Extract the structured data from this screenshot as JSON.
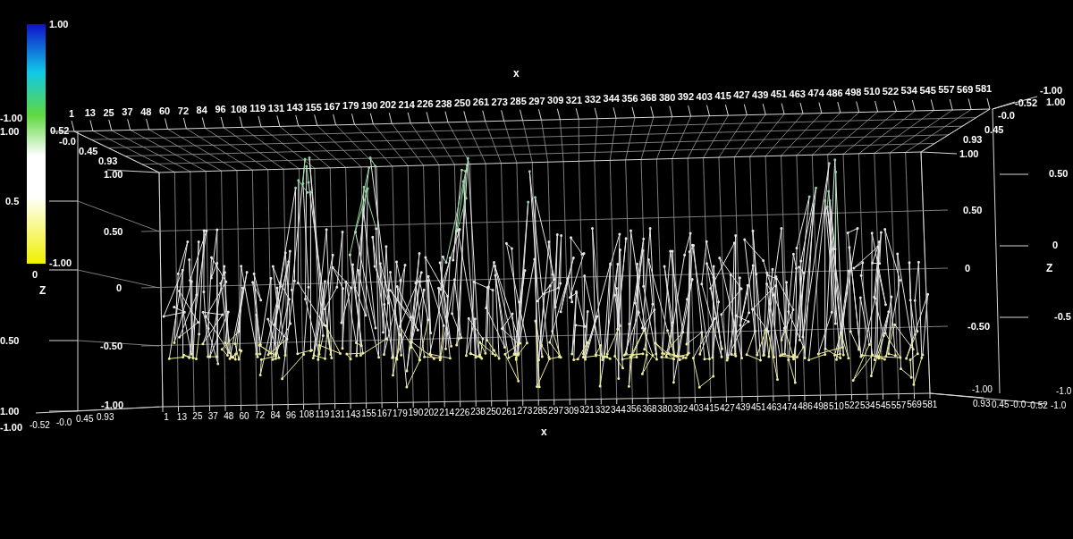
{
  "colorbar": {
    "texts": [
      "1.00",
      "-1.00",
      "1.00",
      "0.5",
      "-1.00",
      "0"
    ]
  },
  "label_groups": [
    {
      "kind": "x-top",
      "title": "x",
      "texts": [
        "1",
        "13",
        "25",
        "37",
        "48",
        "60",
        "72",
        "84",
        "96",
        "108",
        "119",
        "131",
        "143",
        "155",
        "167",
        "179",
        "190",
        "202",
        "214",
        "226",
        "238",
        "250",
        "261",
        "273",
        "285",
        "297",
        "309",
        "321",
        "332",
        "344",
        "356",
        "368",
        "380",
        "392",
        "403",
        "415",
        "427",
        "439",
        "451",
        "463",
        "474",
        "486",
        "498",
        "510",
        "522",
        "534",
        "545",
        "557",
        "569",
        "581"
      ]
    },
    {
      "kind": "left-depth-top",
      "texts": [
        "0.52",
        "-0.0",
        "0.45",
        "0.93"
      ]
    },
    {
      "kind": "left-z-inner",
      "texts": [
        "1.00",
        "0.50",
        "0",
        "-0.50",
        "-1.00"
      ]
    },
    {
      "kind": "left-z-outer",
      "title": "Z",
      "texts": [
        "0.50",
        "1.00",
        "-1.00"
      ]
    },
    {
      "kind": "left-depth-bottom",
      "texts": [
        "-0.52",
        "-0.0",
        "0.45",
        "0.93"
      ]
    },
    {
      "kind": "right-depth-top",
      "texts": [
        "-1.00",
        "-0.52",
        "1.00",
        "-0.0",
        "0.45",
        "0.93",
        "1.00"
      ]
    },
    {
      "kind": "right-z-inner",
      "texts": [
        "0.50",
        "0",
        "-0.50"
      ]
    },
    {
      "kind": "right-z-outer",
      "title": "Z",
      "texts": [
        "0.50",
        "0",
        "-0.5"
      ]
    },
    {
      "kind": "right-depth-bottom",
      "texts": [
        "-1.00",
        "0.93",
        "0.45",
        "-0.0",
        "-0.52",
        "-1.0",
        "-1.0"
      ]
    },
    {
      "kind": "x-bottom",
      "title": "x",
      "texts": [
        "1",
        "13",
        "25",
        "37",
        "48",
        "60",
        "72",
        "84",
        "96",
        "108",
        "119",
        "131",
        "143",
        "155",
        "167",
        "179",
        "190",
        "202",
        "214",
        "226",
        "238",
        "250",
        "261",
        "273",
        "285",
        "297",
        "309",
        "321",
        "332",
        "344",
        "356",
        "368",
        "380",
        "392",
        "403",
        "415",
        "427",
        "439",
        "451",
        "463",
        "474",
        "486",
        "498",
        "510",
        "522",
        "534",
        "545",
        "557",
        "569",
        "581"
      ]
    }
  ]
}
